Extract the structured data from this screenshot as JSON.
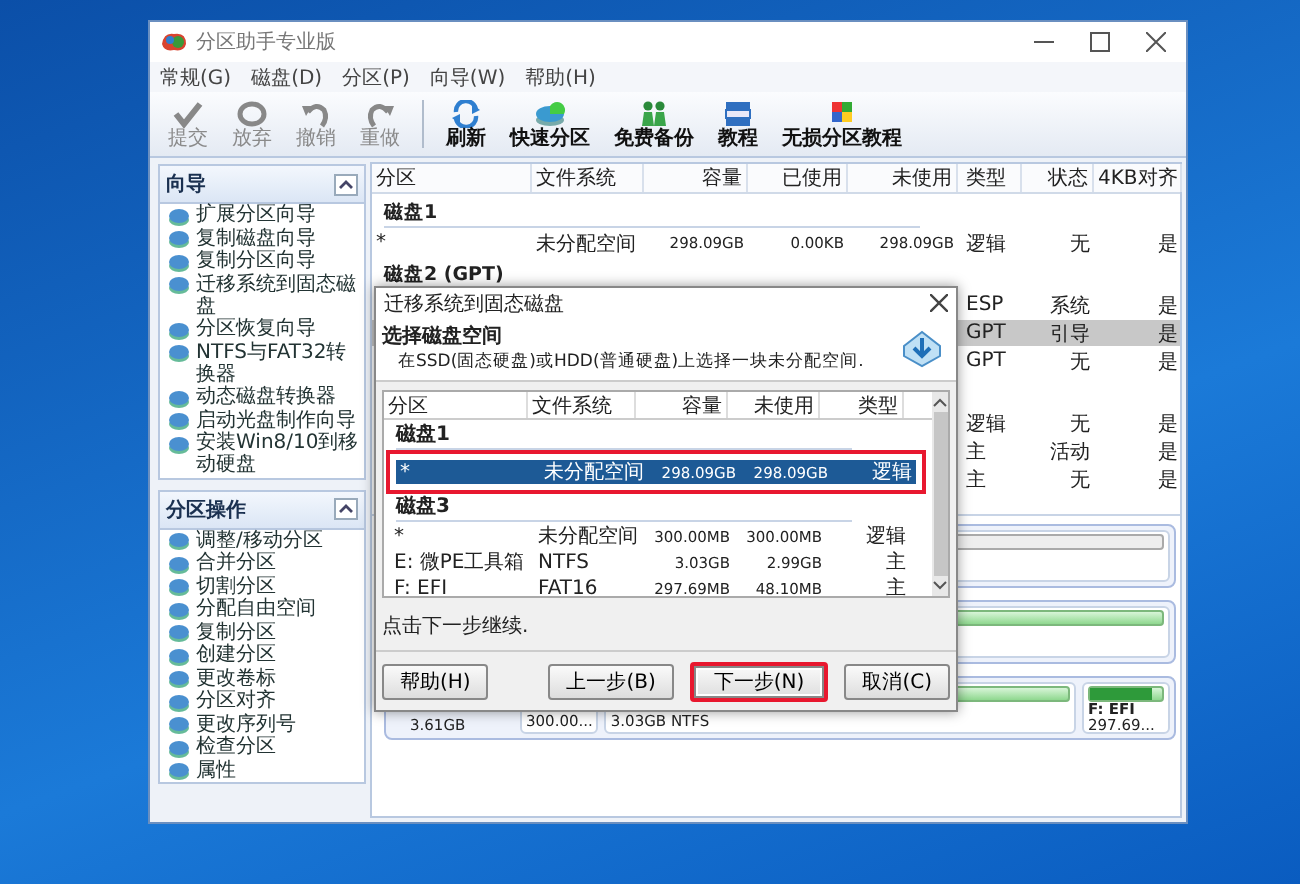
{
  "window": {
    "title": "分区助手专业版"
  },
  "menu": [
    "常规(G)",
    "磁盘(D)",
    "分区(P)",
    "向导(W)",
    "帮助(H)"
  ],
  "toolbar": [
    {
      "label": "提交",
      "kind": "check",
      "disabled": true
    },
    {
      "label": "放弃",
      "kind": "ring",
      "disabled": true
    },
    {
      "label": "撤销",
      "kind": "undo",
      "disabled": true
    },
    {
      "label": "重做",
      "kind": "redo",
      "disabled": true
    },
    {
      "label": "刷新",
      "kind": "refresh",
      "disabled": false
    },
    {
      "label": "快速分区",
      "kind": "disk",
      "disabled": false
    },
    {
      "label": "免费备份",
      "kind": "figures",
      "disabled": false
    },
    {
      "label": "教程",
      "kind": "book",
      "disabled": false
    },
    {
      "label": "无损分区教程",
      "kind": "squares",
      "disabled": false
    }
  ],
  "sidebar": {
    "sections": [
      {
        "title": "向导",
        "items": [
          "扩展分区向导",
          "复制磁盘向导",
          "复制分区向导",
          "迁移系统到固态磁盘",
          "分区恢复向导",
          "NTFS与FAT32转换器",
          "动态磁盘转换器",
          "启动光盘制作向导",
          "安装Win8/10到移动硬盘"
        ]
      },
      {
        "title": "分区操作",
        "items": [
          "调整/移动分区",
          "合并分区",
          "切割分区",
          "分配自由空间",
          "复制分区",
          "创建分区",
          "更改卷标",
          "分区对齐",
          "更改序列号",
          "检查分区",
          "属性"
        ]
      }
    ]
  },
  "table": {
    "columns": [
      "分区",
      "文件系统",
      "容量",
      "已使用",
      "未使用",
      "类型",
      "状态",
      "4KB对齐"
    ],
    "groups": [
      {
        "title": "磁盘1",
        "rows": [
          {
            "partition": "*",
            "file_system": "未分配空间",
            "capacity": "298.09GB",
            "used": "0.00KB",
            "unused": "298.09GB",
            "type": "逻辑",
            "status": "无",
            "align": "是",
            "selected": false
          }
        ]
      },
      {
        "title": "磁盘2 (GPT)",
        "rows": [
          {
            "type": "ESP",
            "status": "系统",
            "align": "是",
            "selected": false
          },
          {
            "type": "GPT",
            "status": "引导",
            "align": "是",
            "selected": true
          },
          {
            "type": "GPT",
            "status": "无",
            "align": "是",
            "selected": false
          }
        ]
      },
      {
        "rows": [
          {
            "type": "逻辑",
            "status": "无",
            "align": "是",
            "selected": false
          },
          {
            "type": "主",
            "status": "活动",
            "align": "是",
            "selected": false
          },
          {
            "type": "主",
            "status": "无",
            "align": "是",
            "selected": false
          }
        ]
      }
    ]
  },
  "disk_map": [
    {
      "segments": [
        {
          "kind": "unallocated"
        }
      ]
    },
    {
      "segments": [
        {
          "kind": "partition"
        }
      ]
    },
    {
      "size": "3.61GB",
      "segments": [
        {
          "kind": "hidden",
          "detail": "300.00..."
        },
        {
          "kind": "partition",
          "detail": "3.03GB NTFS"
        },
        {
          "kind": "partition",
          "name": "F: EFI",
          "detail": "297.69...",
          "level": 0.85
        }
      ]
    }
  ],
  "dialog": {
    "title": "迁移系统到固态磁盘",
    "heading": "选择磁盘空间",
    "subtitle": "在SSD(固态硬盘)或HDD(普通硬盘)上选择一块未分配空间.",
    "columns": [
      "分区",
      "文件系统",
      "容量",
      "未使用",
      "类型"
    ],
    "groups": [
      {
        "title": "磁盘1",
        "rows": [
          {
            "cells": [
              "*",
              "未分配空间",
              "298.09GB",
              "298.09GB",
              "逻辑"
            ],
            "selected": true,
            "highlighted": true
          }
        ]
      },
      {
        "title": "磁盘3",
        "rows": [
          {
            "cells": [
              "*",
              "未分配空间",
              "300.00MB",
              "300.00MB",
              "逻辑"
            ],
            "selected": false,
            "highlighted": false
          },
          {
            "cells": [
              "E:  微PE工具箱",
              "NTFS",
              "3.03GB",
              "2.99GB",
              "主"
            ],
            "selected": false,
            "highlighted": false
          },
          {
            "cells": [
              "F:  EFI",
              "FAT16",
              "297.69MB",
              "48.10MB",
              "主"
            ],
            "selected": false,
            "highlighted": false
          }
        ]
      }
    ],
    "footer_text": "点击下一步继续.",
    "buttons": [
      {
        "label": "帮助(H)",
        "highlighted": false
      },
      {
        "label": "上一步(B)",
        "highlighted": false
      },
      {
        "label": "下一步(N)",
        "highlighted": true
      },
      {
        "label": "取消(C)",
        "highlighted": false
      }
    ]
  }
}
